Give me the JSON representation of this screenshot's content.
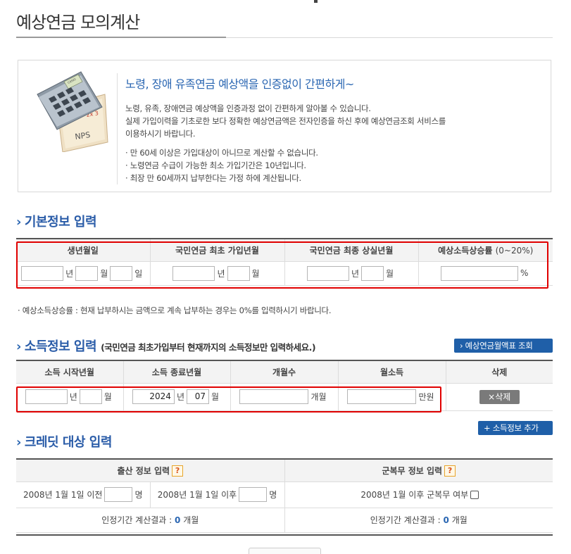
{
  "page": {
    "title": "예상연금 모의계산"
  },
  "intro": {
    "heading": "노령, 장애 유족연금 예상액을 인증없이 간편하게~",
    "line1": "노령, 유족, 장애연금 예상액을 인증과정 없이 간편하게 알아볼 수 있습니다.",
    "line2": "실제 가입이력을 기초로한 보다 정확한 예상연금액은 전자인증을 하신 후에 예상연금조회 서비스를",
    "line3": "이용하시기 바랍니다.",
    "bullet1": "· 만 60세 이상은 가입대상이 아니므로 계산할 수 없습니다.",
    "bullet2": "· 노령연금 수급이 가능한 최소 가입기간은 10년입니다.",
    "bullet3": "· 최장 만 60세까지 납부한다는 가정 하에 계산됩니다.",
    "illustration_label": "NPS",
    "calc_label": "CASIO",
    "paper_marks": "2x 3"
  },
  "basic": {
    "section_title": "기본정보 입력",
    "headers": [
      "생년월일",
      "국민연금 최초 가입년월",
      "국민연금 최종 상실년월",
      "예상소득상승률"
    ],
    "rate_range": "(0~20%)",
    "units": {
      "year": "년",
      "month": "월",
      "day": "일",
      "percent": "%"
    },
    "values": {
      "birth_year": "",
      "birth_month": "",
      "birth_day": "",
      "first_year": "",
      "first_month": "",
      "last_year": "",
      "last_month": "",
      "rate": ""
    },
    "note": "· 예상소득상승률 : 현재 납부하시는 금액으로 계속 납부하는 경우는 0%를 입력하시기 바랍니다."
  },
  "income": {
    "section_title": "소득정보 입력",
    "section_sub": "(국민연금 최초가입부터 현재까지의 소득정보만 입력하세요.)",
    "table_button": "› 예상연금월액표 조회",
    "headers": [
      "소득 시작년월",
      "소득 종료년월",
      "개월수",
      "월소득",
      "삭제"
    ],
    "row": {
      "start_year": "",
      "start_month": "",
      "end_year": "2024",
      "end_month": "07",
      "months": "",
      "income": ""
    },
    "units": {
      "year": "년",
      "month": "월",
      "months_unit": "개월",
      "income_unit": "만원"
    },
    "delete_button": "×삭제",
    "add_button": "+ 소득정보 추가"
  },
  "credit": {
    "section_title": "크레딧 대상 입력",
    "birth_header": "출산 정보 입력",
    "military_header": "군복무 정보 입력",
    "help": "?",
    "before_label": "2008년 1월 1일 이전",
    "after_label": "2008년 1월 1일 이후",
    "person_unit": "명",
    "military_label": "2008년 1월 이후 군복무 여부",
    "birth_result_label": "인정기간 계산결과 :",
    "birth_result_value": "0",
    "military_result_label": "인정기간 계산결과 :",
    "military_result_value": "0",
    "month_unit": "개월",
    "before_value": "",
    "after_value": ""
  },
  "colors": {
    "accent": "#2a66b2",
    "highlight": "#e00000",
    "button": "#1f5fa8"
  }
}
